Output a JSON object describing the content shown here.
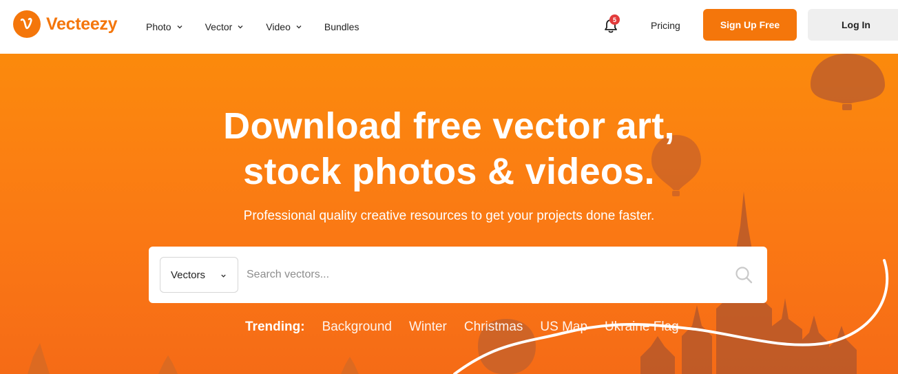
{
  "brand": {
    "name": "Vecteezy",
    "accent_color": "#f4760b"
  },
  "nav": {
    "items": [
      {
        "label": "Photo",
        "has_dropdown": true
      },
      {
        "label": "Vector",
        "has_dropdown": true
      },
      {
        "label": "Video",
        "has_dropdown": true
      },
      {
        "label": "Bundles",
        "has_dropdown": false
      }
    ]
  },
  "notifications": {
    "icon": "bell-icon",
    "count": "5"
  },
  "header_actions": {
    "pricing": "Pricing",
    "signup": "Sign Up Free",
    "login": "Log In"
  },
  "hero": {
    "headline_line1": "Download free vector art,",
    "headline_line2": "stock photos & videos.",
    "subhead": "Professional quality creative resources to get your projects done faster."
  },
  "search": {
    "category": "Vectors",
    "placeholder": "Search vectors...",
    "value": ""
  },
  "trending": {
    "label": "Trending:",
    "items": [
      "Background",
      "Winter",
      "Christmas",
      "US Map",
      "Ukraine Flag"
    ]
  }
}
